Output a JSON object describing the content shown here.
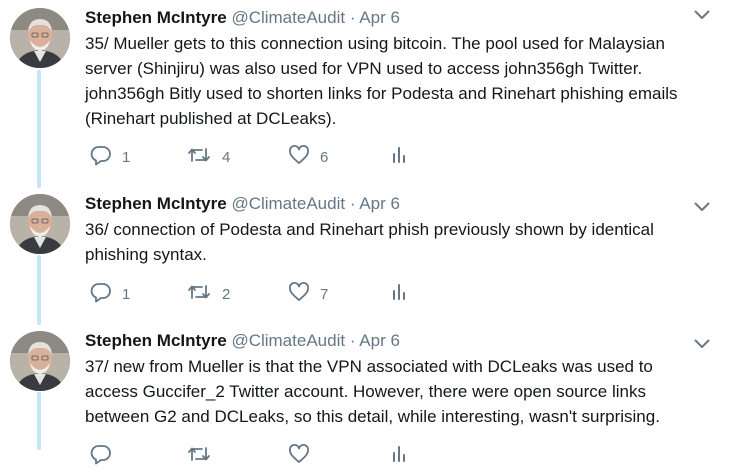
{
  "tweets": [
    {
      "name": "Stephen McIntyre",
      "handle": "@ClimateAudit",
      "separator": "·",
      "time": "Apr 6",
      "text": "35/ Mueller gets to this connection using bitcoin. The pool used for Malaysian\nserver (Shinjiru) was also used for VPN used to access john356gh Twitter.\njohn356gh Bitly used to shorten links for Podesta and Rinehart phishing emails\n(Rinehart published at DCLeaks).",
      "replies": "1",
      "retweets": "4",
      "likes": "6"
    },
    {
      "name": "Stephen McIntyre",
      "handle": "@ClimateAudit",
      "separator": "·",
      "time": "Apr 6",
      "text": "36/ connection of Podesta and Rinehart phish previously shown by identical\nphishing syntax.",
      "replies": "1",
      "retweets": "2",
      "likes": "7"
    },
    {
      "name": "Stephen McIntyre",
      "handle": "@ClimateAudit",
      "separator": "·",
      "time": "Apr 6",
      "text": "37/ new from Mueller is that the VPN associated with DCLeaks was used to\naccess Guccifer_2 Twitter account. However, there were open source links\nbetween G2 and DCLeaks, so this detail, while interesting, wasn't surprising.",
      "replies": "",
      "retweets": "",
      "likes": ""
    }
  ],
  "colors": {
    "thread_line": "#c4e4f8",
    "icon_gray": "#657786",
    "text": "#14171a"
  },
  "icons": [
    "reply-icon",
    "retweet-icon",
    "like-icon",
    "analytics-icon",
    "chevron-down-icon"
  ]
}
